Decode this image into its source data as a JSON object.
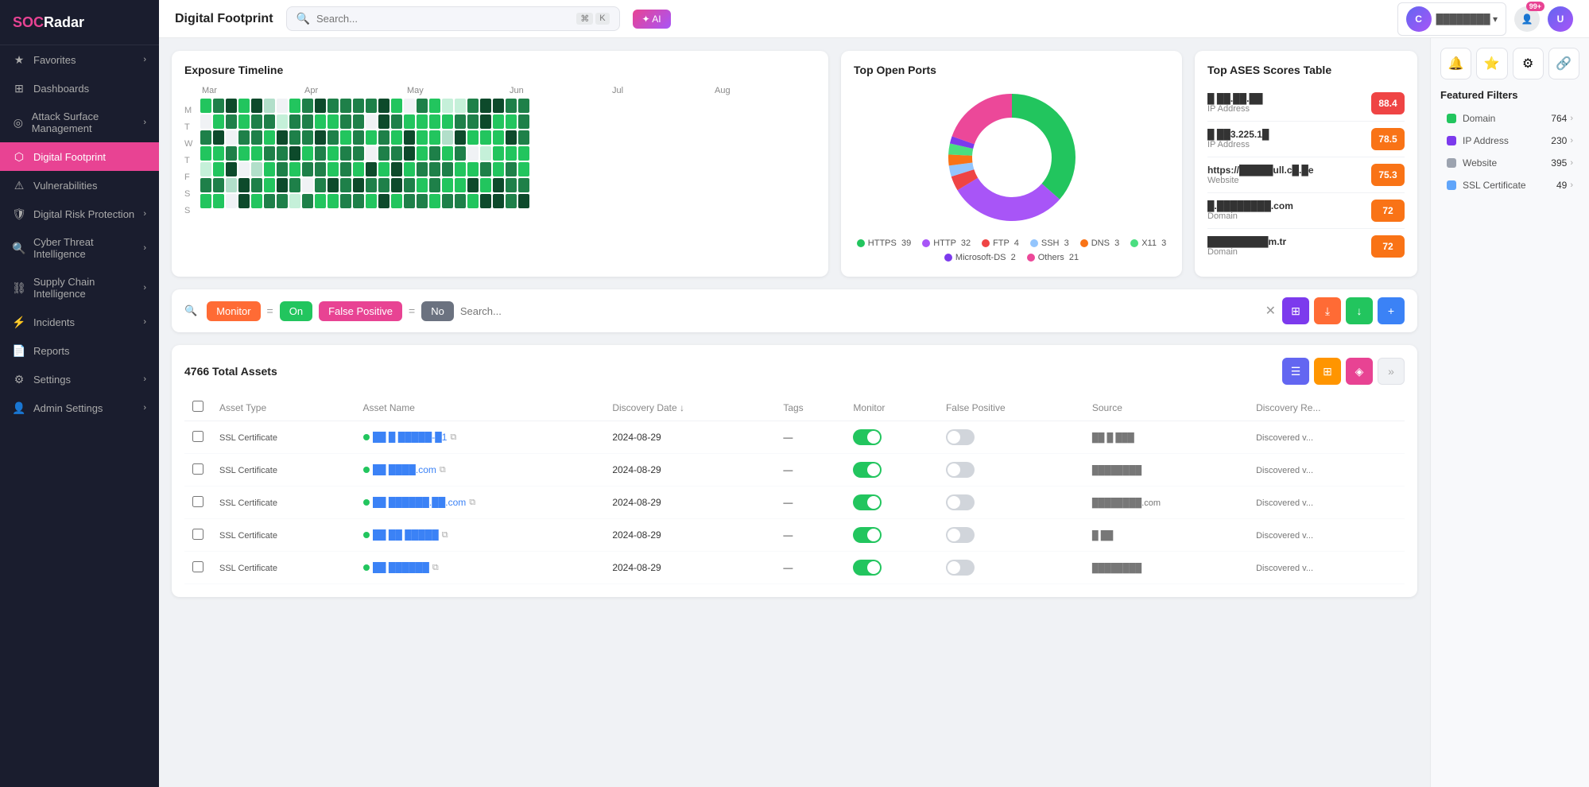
{
  "app": {
    "name": "SOCRadar",
    "page_title": "Digital Footprint"
  },
  "header": {
    "search_placeholder": "Search...",
    "kbd1": "⌘",
    "kbd2": "K",
    "ai_label": "✦ AI"
  },
  "sidebar": {
    "items": [
      {
        "id": "favorites",
        "label": "Favorites",
        "icon": "★",
        "has_chevron": true
      },
      {
        "id": "dashboards",
        "label": "Dashboards",
        "icon": "⊞",
        "has_chevron": false
      },
      {
        "id": "attack-surface",
        "label": "Attack Surface Management",
        "icon": "◎",
        "has_chevron": true
      },
      {
        "id": "digital-footprint",
        "label": "Digital Footprint",
        "icon": "⬡",
        "active": true,
        "has_chevron": false
      },
      {
        "id": "vulnerabilities",
        "label": "Vulnerabilities",
        "icon": "⚠",
        "has_chevron": false
      },
      {
        "id": "digital-risk",
        "label": "Digital Risk Protection",
        "icon": "🛡",
        "has_chevron": true
      },
      {
        "id": "cyber-threat",
        "label": "Cyber Threat Intelligence",
        "icon": "🔍",
        "has_chevron": true
      },
      {
        "id": "supply-chain",
        "label": "Supply Chain Intelligence",
        "icon": "⛓",
        "has_chevron": true
      },
      {
        "id": "incidents",
        "label": "Incidents",
        "icon": "⚡",
        "has_chevron": true
      },
      {
        "id": "reports",
        "label": "Reports",
        "icon": "📄",
        "has_chevron": false
      },
      {
        "id": "settings",
        "label": "Settings",
        "icon": "⚙",
        "has_chevron": true
      },
      {
        "id": "admin-settings",
        "label": "Admin Settings",
        "icon": "👤",
        "has_chevron": true
      }
    ]
  },
  "exposure_timeline": {
    "title": "Exposure Timeline",
    "months": [
      "Mar",
      "Apr",
      "May",
      "Jun",
      "Jul",
      "Aug"
    ],
    "day_labels": [
      "M",
      "T",
      "W",
      "T",
      "F",
      "S",
      "S"
    ]
  },
  "top_open_ports": {
    "title": "Top Open Ports",
    "segments": [
      {
        "label": "HTTPS",
        "count": 39,
        "color": "#22c55e",
        "percentage": 39
      },
      {
        "label": "HTTP",
        "count": 32,
        "color": "#a855f7",
        "percentage": 32
      },
      {
        "label": "FTP",
        "count": 4,
        "color": "#ef4444",
        "percentage": 4
      },
      {
        "label": "SSH",
        "count": 3,
        "color": "#93c5fd",
        "percentage": 3
      },
      {
        "label": "DNS",
        "count": 3,
        "color": "#f97316",
        "percentage": 3
      },
      {
        "label": "X11",
        "count": 3,
        "color": "#4ade80",
        "percentage": 3
      },
      {
        "label": "Microsoft-DS",
        "count": 2,
        "color": "#7c3aed",
        "percentage": 2
      },
      {
        "label": "Others",
        "count": 21,
        "color": "#ec4899",
        "percentage": 21
      }
    ]
  },
  "top_ases": {
    "title": "Top ASES Scores Table",
    "rows": [
      {
        "name": "█ ██.██.██",
        "type": "IP Address",
        "score": 88.4,
        "color": "#ef4444"
      },
      {
        "name": "█ ██3.225.1█",
        "type": "IP Address",
        "score": 78.5,
        "color": "#f97316"
      },
      {
        "name": "https://█████ull.c█.█e",
        "type": "Website",
        "score": 75.3,
        "color": "#f97316"
      },
      {
        "name": "█.████████.com",
        "type": "Domain",
        "score": 72.0,
        "color": "#f97316"
      },
      {
        "name": "█████████m.tr",
        "type": "Domain",
        "score": 72.0,
        "color": "#f97316"
      }
    ]
  },
  "filter_bar": {
    "monitor_label": "Monitor",
    "eq_symbol": "=",
    "on_label": "On",
    "false_positive_label": "False Positive",
    "eq2_symbol": "=",
    "no_label": "No",
    "search_placeholder": "Search..."
  },
  "assets": {
    "total": "4766 Total Assets",
    "columns": [
      "Asset Type",
      "Asset Name",
      "Discovery Date ↓",
      "Tags",
      "Monitor",
      "False Positive",
      "Source",
      "Discovery Re..."
    ],
    "rows": [
      {
        "type": "SSL Certificate",
        "name": "██ █ █████-█1",
        "date": "2024-08-29",
        "monitor_on": true,
        "fp_on": false,
        "source": "██ █ ███",
        "discovery": "Discovered v..."
      },
      {
        "type": "SSL Certificate",
        "name": "██ ████.com",
        "date": "2024-08-29",
        "monitor_on": true,
        "fp_on": false,
        "source": "████████",
        "discovery": "Discovered v..."
      },
      {
        "type": "SSL Certificate",
        "name": "██ ██████.██.com",
        "date": "2024-08-29",
        "monitor_on": true,
        "fp_on": false,
        "source": "████████.com",
        "discovery": "Discovered v..."
      },
      {
        "type": "SSL Certificate",
        "name": "██ ██ █████",
        "date": "2024-08-29",
        "monitor_on": true,
        "fp_on": false,
        "source": "█ ██",
        "discovery": "Discovered v..."
      },
      {
        "type": "SSL Certificate",
        "name": "██ ██████",
        "date": "2024-08-29",
        "monitor_on": true,
        "fp_on": false,
        "source": "████████",
        "discovery": "Discovered v..."
      }
    ]
  },
  "right_panel": {
    "icons": [
      "🔔",
      "⭐",
      "⚙",
      "🔗"
    ],
    "featured_filters_title": "Featured Filters",
    "filters": [
      {
        "label": "Domain",
        "count": 764,
        "color": "#22c55e"
      },
      {
        "label": "IP Address",
        "count": 230,
        "color": "#7c3aed"
      },
      {
        "label": "Website",
        "count": 395,
        "color": "#9ca3af"
      },
      {
        "label": "SSL Certificate",
        "count": 49,
        "color": "#60a5fa"
      }
    ]
  }
}
